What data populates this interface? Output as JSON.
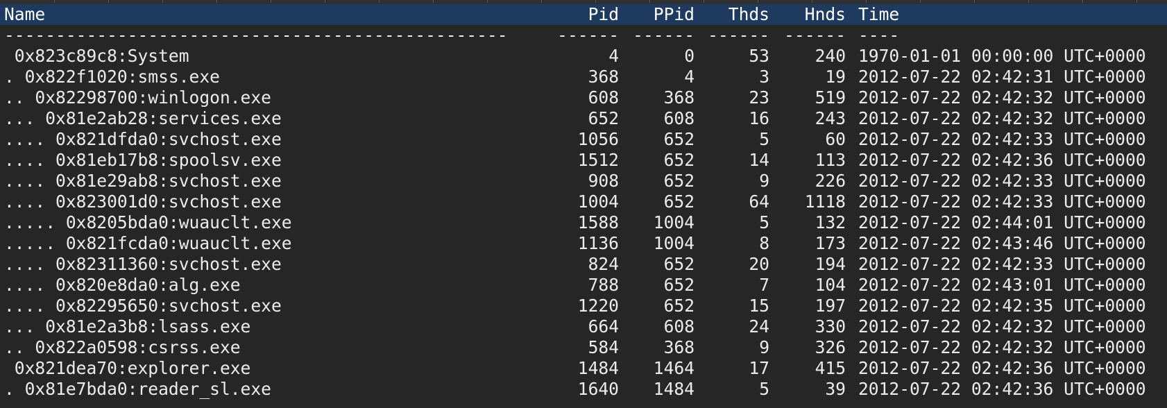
{
  "colors": {
    "background": "#262626",
    "header_background": "#1f3a5f",
    "text": "#ececec"
  },
  "header": {
    "name": "Name",
    "pid": "Pid",
    "ppid": "PPid",
    "thds": "Thds",
    "hnds": "Hnds",
    "time": "Time"
  },
  "separator": {
    "name": "-------------------------------------------------",
    "pid": "------",
    "ppid": "------",
    "thds": "------",
    "hnds": "------",
    "time": "----"
  },
  "rows": [
    {
      "name": " 0x823c89c8:System",
      "pid": "4",
      "ppid": "0",
      "thds": "53",
      "hnds": "240",
      "time": "1970-01-01 00:00:00 UTC+0000"
    },
    {
      "name": ". 0x822f1020:smss.exe",
      "pid": "368",
      "ppid": "4",
      "thds": "3",
      "hnds": "19",
      "time": "2012-07-22 02:42:31 UTC+0000"
    },
    {
      "name": ".. 0x82298700:winlogon.exe",
      "pid": "608",
      "ppid": "368",
      "thds": "23",
      "hnds": "519",
      "time": "2012-07-22 02:42:32 UTC+0000"
    },
    {
      "name": "... 0x81e2ab28:services.exe",
      "pid": "652",
      "ppid": "608",
      "thds": "16",
      "hnds": "243",
      "time": "2012-07-22 02:42:32 UTC+0000"
    },
    {
      "name": ".... 0x821dfda0:svchost.exe",
      "pid": "1056",
      "ppid": "652",
      "thds": "5",
      "hnds": "60",
      "time": "2012-07-22 02:42:33 UTC+0000"
    },
    {
      "name": ".... 0x81eb17b8:spoolsv.exe",
      "pid": "1512",
      "ppid": "652",
      "thds": "14",
      "hnds": "113",
      "time": "2012-07-22 02:42:36 UTC+0000"
    },
    {
      "name": ".... 0x81e29ab8:svchost.exe",
      "pid": "908",
      "ppid": "652",
      "thds": "9",
      "hnds": "226",
      "time": "2012-07-22 02:42:33 UTC+0000"
    },
    {
      "name": ".... 0x823001d0:svchost.exe",
      "pid": "1004",
      "ppid": "652",
      "thds": "64",
      "hnds": "1118",
      "time": "2012-07-22 02:42:33 UTC+0000"
    },
    {
      "name": "..... 0x8205bda0:wuauclt.exe",
      "pid": "1588",
      "ppid": "1004",
      "thds": "5",
      "hnds": "132",
      "time": "2012-07-22 02:44:01 UTC+0000"
    },
    {
      "name": "..... 0x821fcda0:wuauclt.exe",
      "pid": "1136",
      "ppid": "1004",
      "thds": "8",
      "hnds": "173",
      "time": "2012-07-22 02:43:46 UTC+0000"
    },
    {
      "name": ".... 0x82311360:svchost.exe",
      "pid": "824",
      "ppid": "652",
      "thds": "20",
      "hnds": "194",
      "time": "2012-07-22 02:42:33 UTC+0000"
    },
    {
      "name": ".... 0x820e8da0:alg.exe",
      "pid": "788",
      "ppid": "652",
      "thds": "7",
      "hnds": "104",
      "time": "2012-07-22 02:43:01 UTC+0000"
    },
    {
      "name": ".... 0x82295650:svchost.exe",
      "pid": "1220",
      "ppid": "652",
      "thds": "15",
      "hnds": "197",
      "time": "2012-07-22 02:42:35 UTC+0000"
    },
    {
      "name": "... 0x81e2a3b8:lsass.exe",
      "pid": "664",
      "ppid": "608",
      "thds": "24",
      "hnds": "330",
      "time": "2012-07-22 02:42:32 UTC+0000"
    },
    {
      "name": ".. 0x822a0598:csrss.exe",
      "pid": "584",
      "ppid": "368",
      "thds": "9",
      "hnds": "326",
      "time": "2012-07-22 02:42:32 UTC+0000"
    },
    {
      "name": " 0x821dea70:explorer.exe",
      "pid": "1484",
      "ppid": "1464",
      "thds": "17",
      "hnds": "415",
      "time": "2012-07-22 02:42:36 UTC+0000"
    },
    {
      "name": ". 0x81e7bda0:reader_sl.exe",
      "pid": "1640",
      "ppid": "1484",
      "thds": "5",
      "hnds": "39",
      "time": "2012-07-22 02:42:36 UTC+0000"
    }
  ]
}
